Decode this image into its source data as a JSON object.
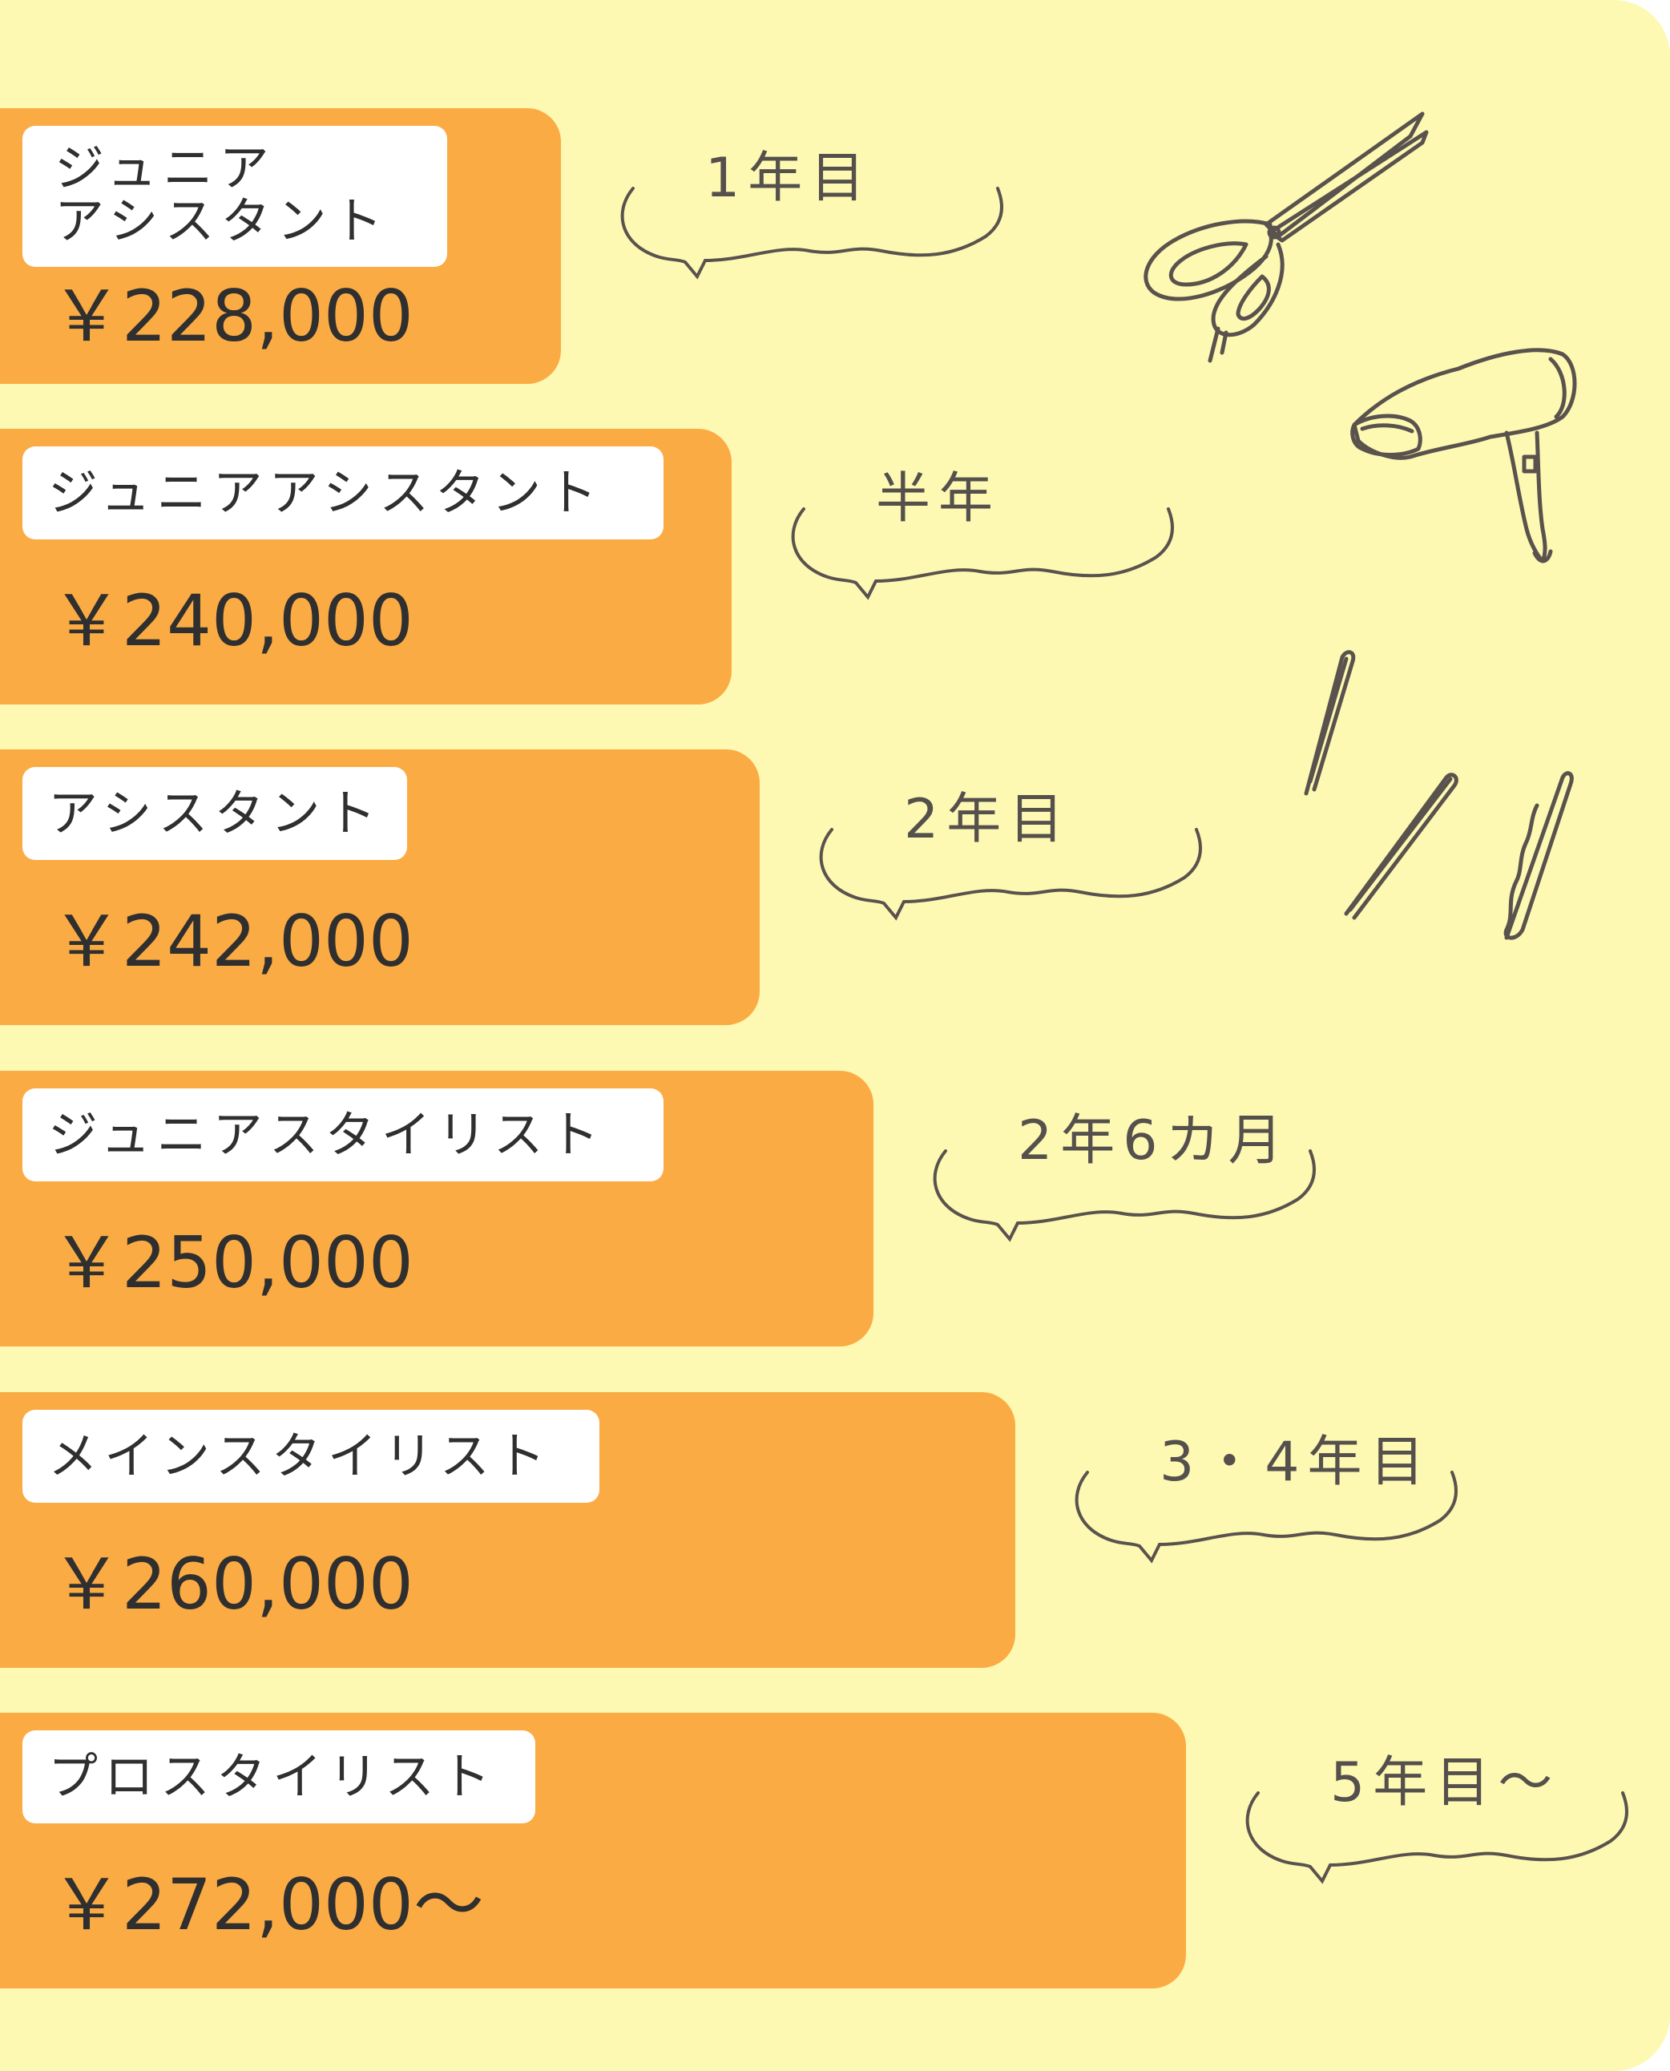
{
  "chart_data": {
    "type": "bar",
    "orientation": "horizontal",
    "categories": [
      "ジュニアアシスタント",
      "ジュニアアシスタント",
      "アシスタント",
      "ジュニアスタイリスト",
      "メインスタイリスト",
      "プロスタイリスト"
    ],
    "values": [
      228000,
      240000,
      242000,
      250000,
      260000,
      272000
    ],
    "bars": [
      {
        "title_lines": [
          "ジュニア",
          "アシスタント"
        ],
        "salary": "￥228,000",
        "tenure": "1年目"
      },
      {
        "title_lines": [
          "ジュニアアシスタント"
        ],
        "salary": "￥240,000",
        "tenure": "半年"
      },
      {
        "title_lines": [
          "アシスタント"
        ],
        "salary": "￥242,000",
        "tenure": "2年目"
      },
      {
        "title_lines": [
          "ジュニアスタイリスト"
        ],
        "salary": "￥250,000",
        "tenure": "2年6カ月"
      },
      {
        "title_lines": [
          "メインスタイリスト"
        ],
        "salary": "￥260,000",
        "tenure": "3・4年目"
      },
      {
        "title_lines": [
          "プロスタイリスト"
        ],
        "salary": "￥272,000～",
        "tenure": "5年目～"
      }
    ],
    "grid": false,
    "legend": "none"
  },
  "colors": {
    "background": "#fdf8b2",
    "bar": "#fbab43",
    "label_box": "#ffffff",
    "text": "#2f2f2f",
    "sketch": "#5a524d"
  },
  "decorations": [
    "scissors-icon",
    "hair-dryer-icon",
    "hairpin-icon"
  ]
}
